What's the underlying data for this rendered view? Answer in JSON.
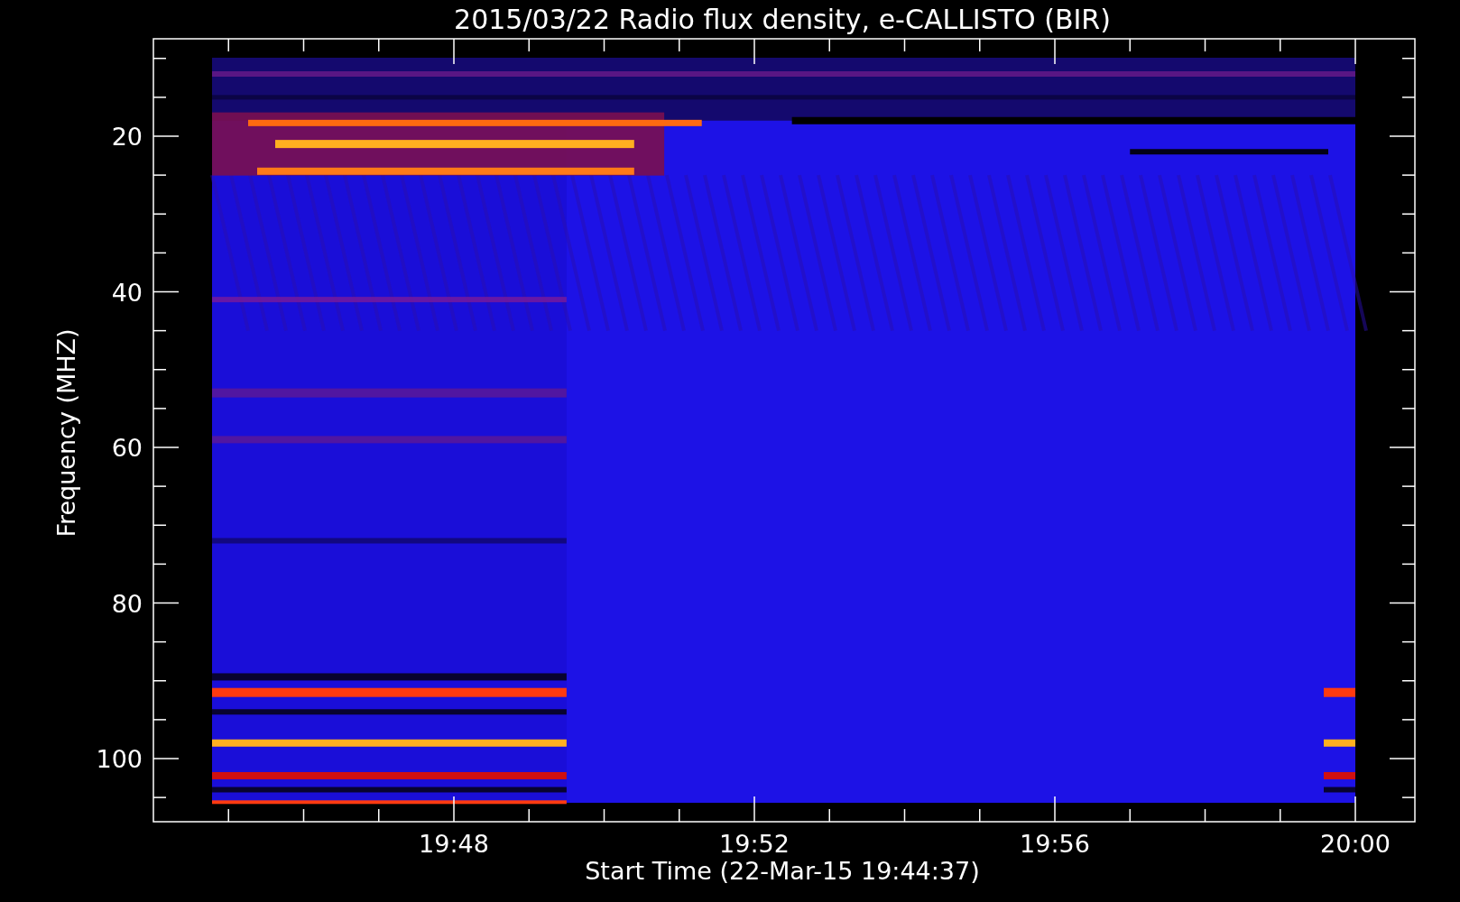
{
  "plot": {
    "title": "2015/03/22  Radio flux density, e-CALLISTO (BIR)",
    "ylabel": "Frequency (MHZ)",
    "xlabel": "Start Time (22-Mar-15 19:44:37)",
    "yticks": [
      "20",
      "40",
      "60",
      "80",
      "100"
    ],
    "xticks": [
      "19:48",
      "19:52",
      "19:56",
      "20:00"
    ]
  }
}
